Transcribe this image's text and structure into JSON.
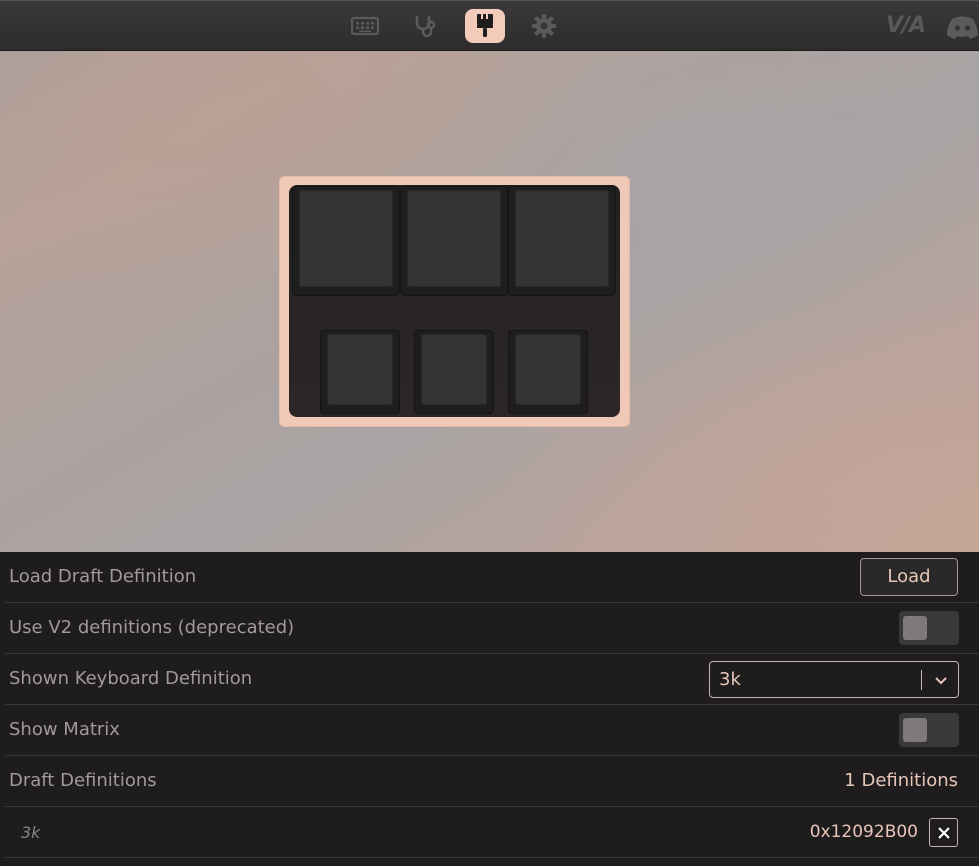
{
  "topbar": {
    "icons": [
      "keyboard-icon",
      "stethoscope-icon",
      "paintbrush-icon",
      "gear-icon"
    ],
    "active_icon": "paintbrush-icon",
    "logo": "V/A",
    "right_icon": "discord-icon"
  },
  "keyboard": {
    "name": "3k",
    "rows": [
      3,
      3
    ]
  },
  "settings": {
    "load_draft": {
      "label": "Load Draft Definition",
      "button": "Load"
    },
    "use_v2": {
      "label": "Use V2 definitions (deprecated)",
      "enabled": false
    },
    "shown_definition": {
      "label": "Shown Keyboard Definition",
      "value": "3k"
    },
    "show_matrix": {
      "label": "Show Matrix",
      "enabled": false
    },
    "draft_definitions": {
      "label": "Draft Definitions",
      "count_text": "1 Definitions"
    },
    "definitions": [
      {
        "name": "3k",
        "id": "0x12092B00"
      }
    ]
  },
  "colors": {
    "accent": "#f2cbbb",
    "panel_bg": "#1e1c1d",
    "text_muted": "#a09a98",
    "text_accent": "#e8c7b9"
  }
}
